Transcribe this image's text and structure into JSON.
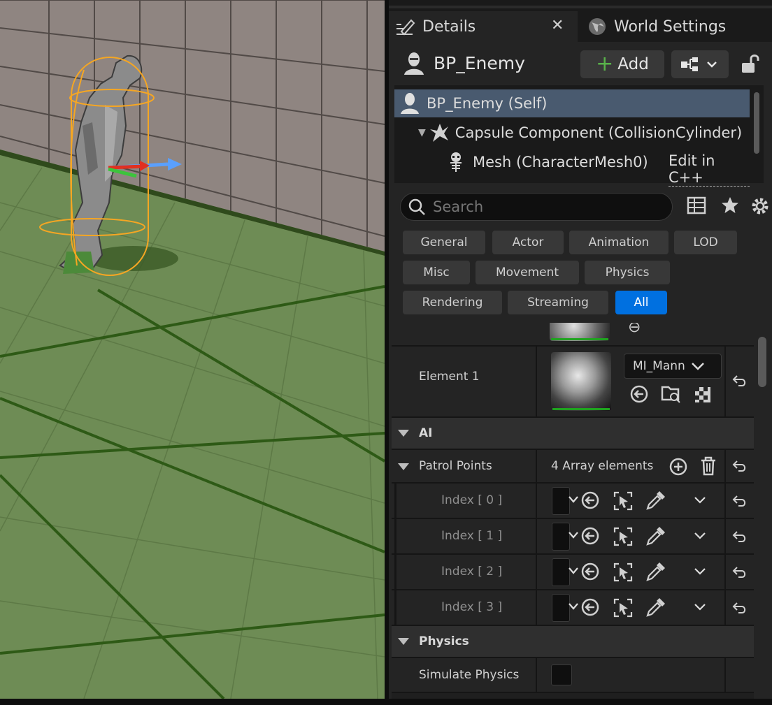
{
  "tabs": {
    "details_label": "Details",
    "world_settings_label": "World Settings"
  },
  "header": {
    "actor_name": "BP_Enemy",
    "add_label": "Add"
  },
  "components": [
    {
      "label": "BP_Enemy (Self)"
    },
    {
      "label": "Capsule Component (CollisionCylinder)"
    },
    {
      "label": "Mesh (CharacterMesh0)",
      "link": "Edit in C++"
    }
  ],
  "search": {
    "placeholder": "Search"
  },
  "filters": [
    {
      "label": "General"
    },
    {
      "label": "Actor"
    },
    {
      "label": "Animation"
    },
    {
      "label": "LOD"
    },
    {
      "label": "Misc"
    },
    {
      "label": "Movement"
    },
    {
      "label": "Physics"
    },
    {
      "label": "Rendering"
    },
    {
      "label": "Streaming"
    },
    {
      "label": "All",
      "selected": true
    }
  ],
  "materials": {
    "element1_label": "Element 1",
    "element1_value": "MI_Mann"
  },
  "sections": {
    "ai": "AI",
    "physics": "Physics"
  },
  "patrol": {
    "label": "Patrol Points",
    "count": "4 Array elements",
    "indices": [
      "Index [ 0 ]",
      "Index [ 1 ]",
      "Index [ 2 ]",
      "Index [ 3 ]"
    ]
  },
  "physics": {
    "simulate_label": "Simulate Physics"
  },
  "colors": {
    "selection": "#495a6f",
    "accent_blue": "#0070e0",
    "add_green": "#59b24a",
    "bounds_orange": "#f5a623"
  }
}
